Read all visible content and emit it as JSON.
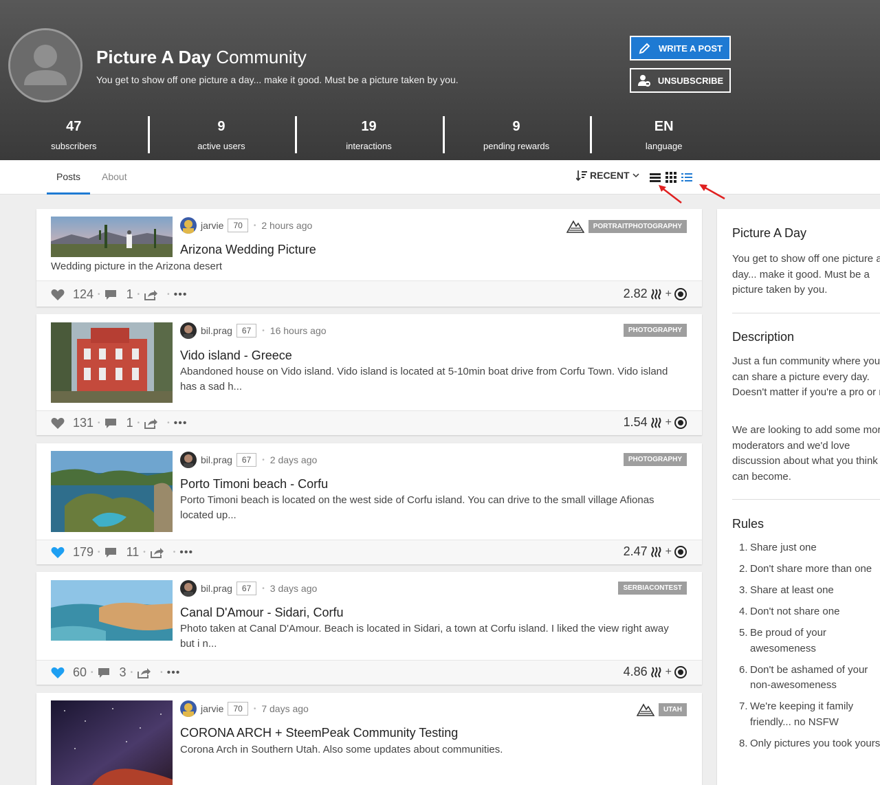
{
  "community": {
    "title_bold": "Picture A Day",
    "title_rest": " Community",
    "subtitle": "You get to show off one picture a day... make it good. Must be a picture taken by you.",
    "write_label": "WRITE A POST",
    "unsubscribe_label": "UNSUBSCRIBE",
    "stats": [
      {
        "value": "47",
        "label": "subscribers"
      },
      {
        "value": "9",
        "label": "active users"
      },
      {
        "value": "19",
        "label": "interactions"
      },
      {
        "value": "9",
        "label": "pending rewards"
      },
      {
        "value": "EN",
        "label": "language"
      }
    ]
  },
  "tabs": [
    {
      "label": "Posts"
    },
    {
      "label": "About"
    }
  ],
  "sort": {
    "label": "RECENT"
  },
  "posts": [
    {
      "author": "jarvie",
      "rep": "70",
      "time": "2 hours ago",
      "tag": "PORTRAITPHOTOGRAPHY",
      "title": "Arizona Wedding Picture",
      "desc": "Wedding picture in the Arizona desert",
      "votes": "124",
      "comments": "1",
      "payout": "2.82",
      "liked": false
    },
    {
      "author": "bil.prag",
      "rep": "67",
      "time": "16 hours ago",
      "tag": "PHOTOGRAPHY",
      "title": "Vido island - Greece",
      "desc": "Abandoned house on Vido island. Vido island is located at 5-10min boat drive from Corfu Town. Vido island has a sad h...",
      "votes": "131",
      "comments": "1",
      "payout": "1.54",
      "liked": false
    },
    {
      "author": "bil.prag",
      "rep": "67",
      "time": "2 days ago",
      "tag": "PHOTOGRAPHY",
      "title": "Porto Timoni beach - Corfu",
      "desc": "Porto Timoni beach is located on the west side of Corfu island. You can drive to the small village Afionas located up...",
      "votes": "179",
      "comments": "11",
      "payout": "2.47",
      "liked": true
    },
    {
      "author": "bil.prag",
      "rep": "67",
      "time": "3 days ago",
      "tag": "SERBIACONTEST",
      "title": "Canal D'Amour - Sidari, Corfu",
      "desc": "Photo taken at Canal D'Amour. Beach is located in Sidari, a town at Corfu island. I liked the view right away but i n...",
      "votes": "60",
      "comments": "3",
      "payout": "4.86",
      "liked": true
    },
    {
      "author": "jarvie",
      "rep": "70",
      "time": "7 days ago",
      "tag": "UTAH",
      "title": "CORONA ARCH + SteemPeak Community Testing",
      "desc": "Corona Arch in Southern Utah. Also some updates about communities."
    }
  ],
  "sidebar": {
    "title": "Picture A Day",
    "about": "You get to show off one picture a day... make it good. Must be a picture taken by you.",
    "description_heading": "Description",
    "description_p1": "Just a fun community where you can share a picture every day. Doesn't matter if you're a pro or not.",
    "description_p2": "We are looking to add some more moderators and we'd love discussion about what you think this can become.",
    "rules_heading": "Rules",
    "rules": [
      {
        "n": "1.",
        "text": "Share just one"
      },
      {
        "n": "2.",
        "text": "Don't share more than one"
      },
      {
        "n": "3.",
        "text": "Share at least one"
      },
      {
        "n": "4.",
        "text": "Don't not share one"
      },
      {
        "n": "5.",
        "text": "Be proud of your awesomeness"
      },
      {
        "n": "6.",
        "text": "Don't be ashamed of your non-awesomeness"
      },
      {
        "n": "7.",
        "text": "We're keeping it family friendly... no NSFW"
      },
      {
        "n": "8.",
        "text": "Only pictures you took yourself"
      }
    ]
  },
  "colors": {
    "accent": "#1e7ad3",
    "like_active": "#1e9ff2",
    "tag": "#9e9e9e",
    "arrow": "#e02020"
  }
}
